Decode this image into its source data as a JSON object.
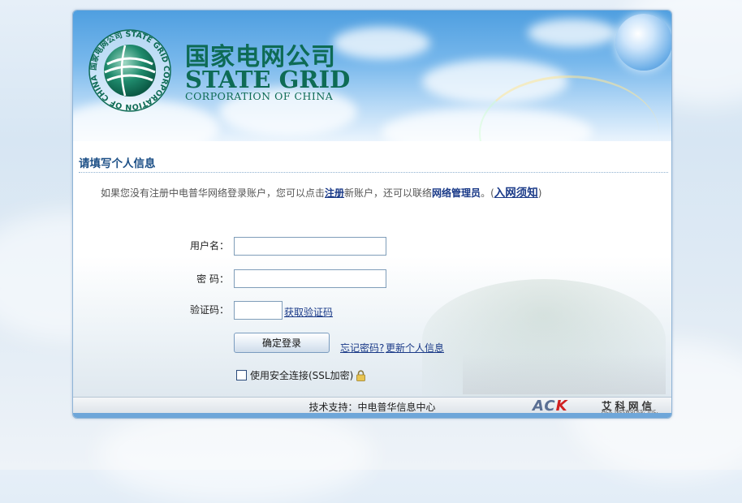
{
  "colors": {
    "brand_green": "#0e6b55",
    "title_blue": "#1c4f86",
    "link_blue": "#1a3a88",
    "ack_red": "#d02020"
  },
  "banner": {
    "logo_ring_text": "国家电网公司 STATE GRID CORPORATION OF CHINA",
    "brand_cn": "国家电网公司",
    "brand_en": "STATE GRID",
    "brand_sub": "CORPORATION OF CHINA"
  },
  "form": {
    "section_title": "请填写个人信息",
    "notice": {
      "prefix": "如果您没有注册中电普华网络登录账户，您可以点击",
      "register_link": "注册",
      "middle": "新账户，还可以联络",
      "admin_link": "网络管理员",
      "suffix_open": "。(",
      "access_link": "入网须知",
      "suffix_close": ")"
    },
    "username_label": "用户名：",
    "username_value": "",
    "password_label": "密  码：",
    "password_value": "",
    "captcha_label": "验证码：",
    "captcha_value": "",
    "get_captcha_link": "获取验证码",
    "login_button": "确定登录",
    "forgot_password_link": "忘记密码?",
    "update_info_link": "更新个人信息",
    "ssl_label": "使用安全连接(SSL加密)",
    "ssl_checked": false,
    "ssl_icon": "lock-icon"
  },
  "footer": {
    "support_text": "技术支持：中电普华信息中心",
    "ack_mark": "ACK",
    "ack_cn": "艾科网信",
    "ack_en": "Ack Networks, Inc."
  }
}
